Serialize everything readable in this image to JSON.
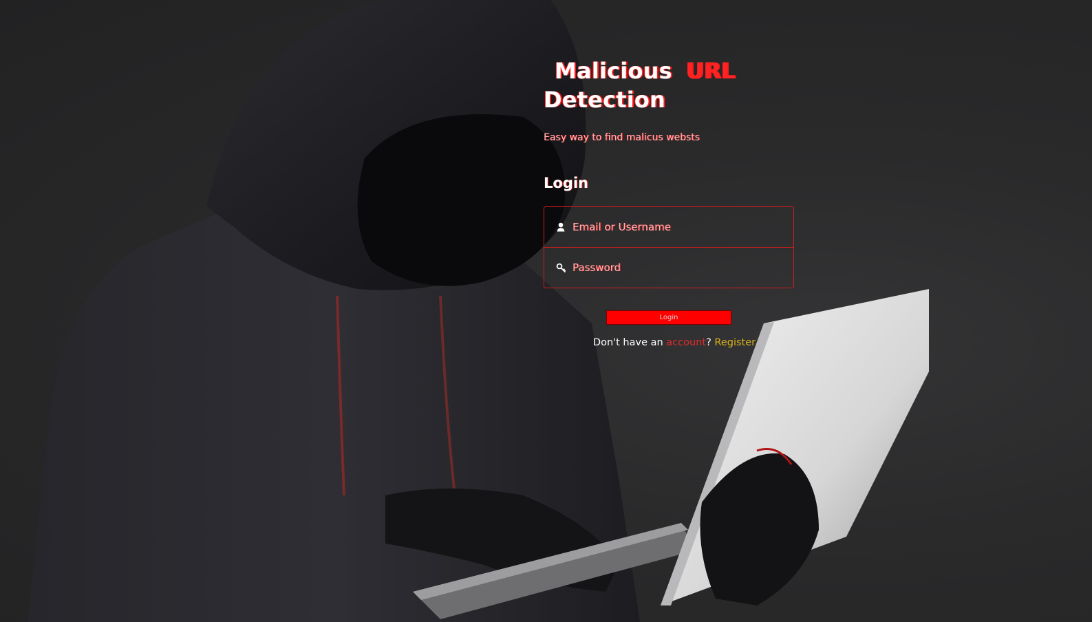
{
  "brand": {
    "title_word1": "Malicious",
    "title_word2": "URL",
    "title_word3": "Detection",
    "tagline": "Easy way to find malicus websts"
  },
  "login": {
    "heading": "Login",
    "username_placeholder": "Email or Username",
    "password_placeholder": "Password",
    "submit_label": "Login",
    "register_prompt_start": "Don't have an ",
    "register_prompt_mid": "account",
    "register_prompt_end": "? ",
    "register_link": "Register"
  },
  "colors": {
    "accent": "#ff0000",
    "background": "#262627",
    "link": "#d9b21a"
  },
  "icons": {
    "username": "user-icon",
    "password": "key-icon"
  }
}
